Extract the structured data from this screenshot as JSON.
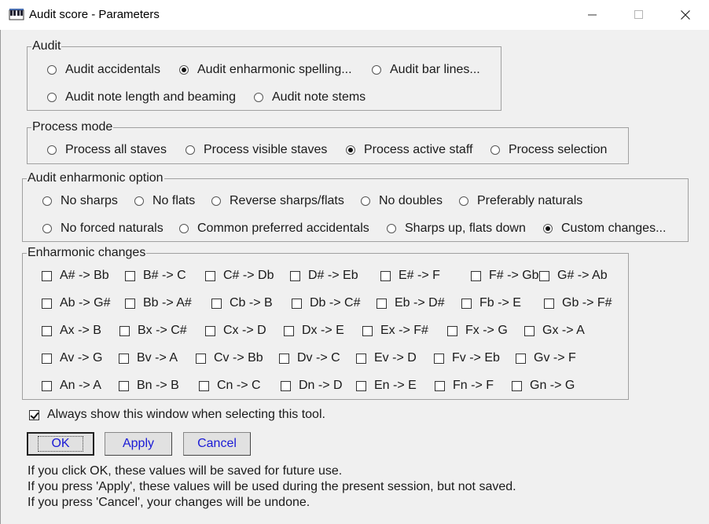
{
  "window": {
    "title": "Audit score - Parameters"
  },
  "audit": {
    "legend": "Audit",
    "options": [
      {
        "label": "Audit accidentals",
        "selected": false
      },
      {
        "label": "Audit enharmonic spelling...",
        "selected": true
      },
      {
        "label": "Audit bar lines...",
        "selected": false
      },
      {
        "label": "Audit note length and beaming",
        "selected": false
      },
      {
        "label": "Audit note stems",
        "selected": false
      }
    ]
  },
  "process_mode": {
    "legend": "Process mode",
    "options": [
      {
        "label": "Process all staves",
        "selected": false
      },
      {
        "label": "Process visible staves",
        "selected": false
      },
      {
        "label": "Process active staff",
        "selected": true
      },
      {
        "label": "Process selection",
        "selected": false
      }
    ]
  },
  "enharmonic_option": {
    "legend": "Audit enharmonic option",
    "options": [
      {
        "label": "No sharps",
        "selected": false
      },
      {
        "label": "No flats",
        "selected": false
      },
      {
        "label": "Reverse sharps/flats",
        "selected": false
      },
      {
        "label": "No doubles",
        "selected": false
      },
      {
        "label": "Preferably naturals",
        "selected": false
      },
      {
        "label": "No forced naturals",
        "selected": false
      },
      {
        "label": "Common preferred accidentals",
        "selected": false
      },
      {
        "label": "Sharps up, flats down",
        "selected": false
      },
      {
        "label": "Custom changes...",
        "selected": true
      }
    ]
  },
  "enharmonic_changes": {
    "legend": "Enharmonic changes",
    "rows": [
      [
        "A# -> Bb",
        "B# -> C",
        "C# -> Db",
        "D# -> Eb",
        "E# -> F",
        "F# -> Gb",
        "G# -> Ab"
      ],
      [
        "Ab -> G#",
        "Bb -> A#",
        "Cb -> B",
        "Db -> C#",
        "Eb -> D#",
        "Fb -> E",
        "Gb -> F#"
      ],
      [
        "Ax -> B",
        "Bx -> C#",
        "Cx -> D",
        "Dx -> E",
        "Ex -> F#",
        "Fx -> G",
        "Gx -> A"
      ],
      [
        "Av -> G",
        "Bv -> A",
        "Cv -> Bb",
        "Dv -> C",
        "Ev -> D",
        "Fv -> Eb",
        "Gv -> F"
      ],
      [
        "An -> A",
        "Bn -> B",
        "Cn -> C",
        "Dn -> D",
        "En -> E",
        "Fn -> F",
        "Gn -> G"
      ]
    ]
  },
  "always_show": {
    "label": "Always show this window when selecting this tool.",
    "checked": true
  },
  "buttons": {
    "ok": "OK",
    "apply": "Apply",
    "cancel": "Cancel"
  },
  "help_lines": [
    "If you click OK, these values will be saved for future use.",
    "If you press 'Apply', these values will be used during the present session, but not saved.",
    "If you press 'Cancel', your changes will be undone."
  ],
  "icons": {
    "app": "piano-keys-icon",
    "minimize": "minimize-icon",
    "maximize": "maximize-icon",
    "close": "close-icon"
  }
}
